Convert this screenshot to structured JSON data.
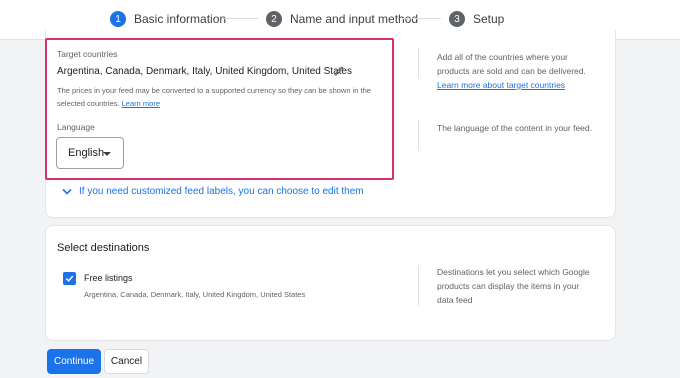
{
  "stepper": {
    "steps": [
      {
        "number": "1",
        "label": "Basic information",
        "state": "active"
      },
      {
        "number": "2",
        "label": "Name and input method",
        "state": "inactive"
      },
      {
        "number": "3",
        "label": "Setup",
        "state": "inactive"
      }
    ]
  },
  "target_countries": {
    "label": "Target countries",
    "value": "Argentina, Canada, Denmark, Italy, United Kingdom, United States",
    "helper_text": "The prices in your feed may be converted to a supported currency so they can be shown in the selected countries.",
    "helper_link": "Learn more",
    "side_text": "Add all of the countries where your products are sold and can be delivered.",
    "side_link": "Learn more about target countries"
  },
  "language": {
    "label": "Language",
    "selected": "English",
    "side_text": "The language of the content in your feed."
  },
  "feed_labels": {
    "text": "If you need customized feed labels, you can choose to edit them"
  },
  "destinations": {
    "title": "Select destinations",
    "free_listings": {
      "label": "Free listings",
      "checked": true,
      "countries": "Argentina, Canada, Denmark, Italy, United Kingdom, United States"
    },
    "side_text": "Destinations let you select which Google products can display the items in your data feed"
  },
  "buttons": {
    "continue": "Continue",
    "cancel": "Cancel"
  },
  "colors": {
    "accent": "#1a73e8",
    "highlight_border": "#d5306f",
    "background": "#f1f3f4"
  }
}
